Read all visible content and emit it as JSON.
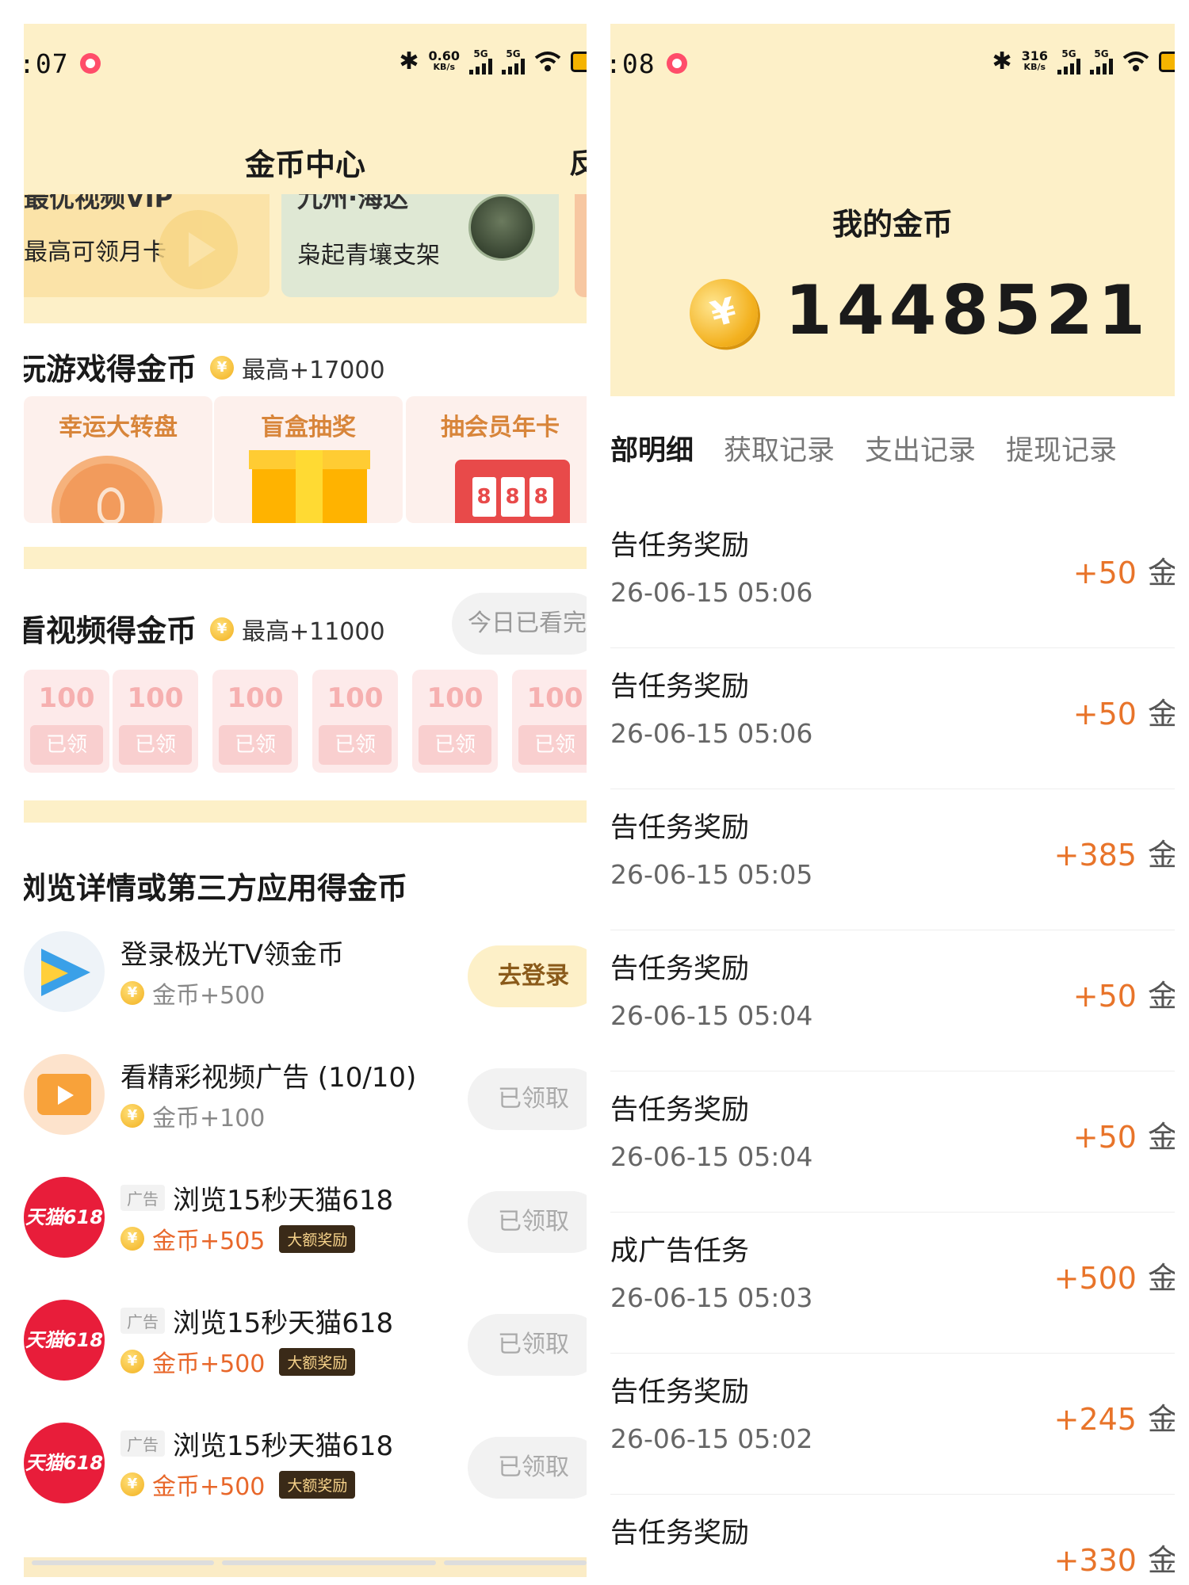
{
  "left": {
    "status": {
      "time": ":07",
      "speed_value": "0.60",
      "speed_unit": "KB/s",
      "sim1": "5G",
      "sim2": "5G"
    },
    "header": {
      "title": "金币中心",
      "action": "反"
    },
    "banners": [
      {
        "top": "最优视频VIP",
        "sub": "最高可领月卡"
      },
      {
        "top": "九州·海达",
        "sub": "枭起青壤支架"
      }
    ],
    "games_section": {
      "title": "玩游戏得金币",
      "coin": "¥",
      "bonus": "最高+17000",
      "cards": [
        "幸运大转盘",
        "盲盒抽奖",
        "抽会员年卡"
      ],
      "slot_digits": [
        "8",
        "8",
        "8"
      ]
    },
    "video_section": {
      "title": "看视频得金币",
      "coin": "¥",
      "bonus": "最高+11000",
      "status": "今日已看完",
      "chips": [
        {
          "value": "100",
          "state": "已领"
        },
        {
          "value": "100",
          "state": "已领"
        },
        {
          "value": "100",
          "state": "已领"
        },
        {
          "value": "100",
          "state": "已领"
        },
        {
          "value": "100",
          "state": "已领"
        },
        {
          "value": "100",
          "state": "已领"
        }
      ]
    },
    "tasks_section": {
      "title": "浏览详情或第三方应用得金币",
      "tasks": [
        {
          "icon": "tv-app-icon",
          "ad": "",
          "title": "登录极光TV领金币",
          "reward": "金币+500",
          "big": "",
          "button": "去登录",
          "hot": false
        },
        {
          "icon": "video-ad-icon",
          "ad": "",
          "title": "看精彩视频广告 (10/10)",
          "reward": "金币+100",
          "big": "",
          "button": "已领取",
          "hot": false
        },
        {
          "icon": "tmall-icon",
          "ad": "广告",
          "title": "浏览15秒天猫618",
          "reward": "金币+505",
          "big": "大额奖励",
          "button": "已领取",
          "hot": true
        },
        {
          "icon": "tmall-icon",
          "ad": "广告",
          "title": "浏览15秒天猫618",
          "reward": "金币+500",
          "big": "大额奖励",
          "button": "已领取",
          "hot": true
        },
        {
          "icon": "tmall-icon",
          "ad": "广告",
          "title": "浏览15秒天猫618",
          "reward": "金币+500",
          "big": "大额奖励",
          "button": "已领取",
          "hot": true
        }
      ],
      "tmall_logo": "天猫618",
      "coin": "¥"
    }
  },
  "right": {
    "status": {
      "time": ":08",
      "speed_value": "316",
      "speed_unit": "KB/s",
      "sim1": "5G",
      "sim2": "5G"
    },
    "my_coins_label": "我的金币",
    "coin_symbol": "¥",
    "total": "1448521",
    "tabs": [
      "部明细",
      "获取记录",
      "支出记录",
      "提现记录"
    ],
    "records": [
      {
        "title": "告任务奖励",
        "date": "26-06-15 05:06",
        "amount": "+50",
        "unit": "金"
      },
      {
        "title": "告任务奖励",
        "date": "26-06-15 05:06",
        "amount": "+50",
        "unit": "金"
      },
      {
        "title": "告任务奖励",
        "date": "26-06-15 05:05",
        "amount": "+385",
        "unit": "金"
      },
      {
        "title": "告任务奖励",
        "date": "26-06-15 05:04",
        "amount": "+50",
        "unit": "金"
      },
      {
        "title": "告任务奖励",
        "date": "26-06-15 05:04",
        "amount": "+50",
        "unit": "金"
      },
      {
        "title": "成广告任务",
        "date": "26-06-15 05:03",
        "amount": "+500",
        "unit": "金"
      },
      {
        "title": "告任务奖励",
        "date": "26-06-15 05:02",
        "amount": "+245",
        "unit": "金"
      },
      {
        "title": "告任务奖励",
        "date": "",
        "amount": "+330",
        "unit": "金"
      }
    ]
  },
  "colors": {
    "header_bg": "#fdf0c8",
    "accent_orange": "#e8742a",
    "coin_gold": "#f2b01e",
    "tmall_red": "#e81d3a"
  }
}
